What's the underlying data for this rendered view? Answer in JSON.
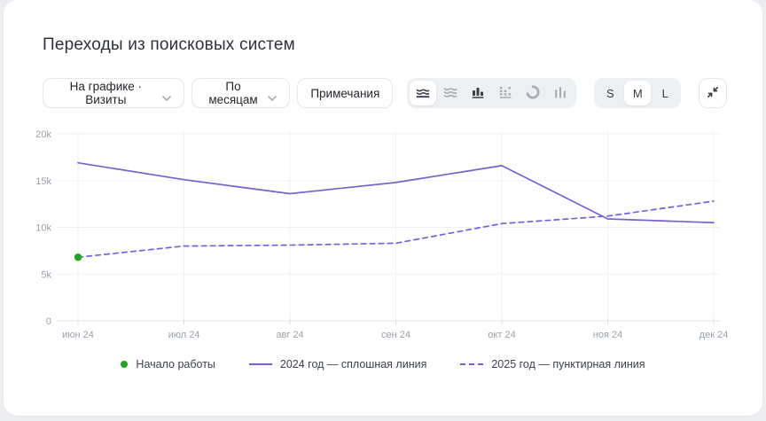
{
  "card": {
    "title": "Переходы из поисковых систем"
  },
  "controls": {
    "metric_dropdown": "На графике · Визиты",
    "period_dropdown": "По месяцам",
    "notes_button": "Примечания",
    "chart_types": [
      {
        "name": "line-chart",
        "selected": true
      },
      {
        "name": "stacked-area-chart",
        "selected": false
      },
      {
        "name": "bar-chart",
        "selected": false
      },
      {
        "name": "stacked-bar-chart",
        "selected": false
      },
      {
        "name": "donut-chart",
        "selected": false
      },
      {
        "name": "column-chart",
        "selected": false
      }
    ],
    "size_options": [
      {
        "label": "S",
        "selected": false
      },
      {
        "label": "M",
        "selected": true
      },
      {
        "label": "L",
        "selected": false
      }
    ],
    "collapse_icon": "collapse-arrows"
  },
  "colors": {
    "solid_line": "#7a5fd0",
    "dashed_line": "#6f63e2",
    "annotation_green": "#22a522",
    "grid": "#eff1f4",
    "axis": "#e3e6eb",
    "tick_text": "#9aa1aa"
  },
  "chart_data": {
    "type": "line",
    "categories": [
      "июн 24",
      "июл 24",
      "авг 24",
      "сен 24",
      "окт 24",
      "ноя 24",
      "дек 24"
    ],
    "series": [
      {
        "name": "2024 год — сплошная линия",
        "style": "solid",
        "color": "#7a5fd0",
        "values": [
          16900,
          15100,
          13600,
          14800,
          16600,
          10900,
          10500
        ]
      },
      {
        "name": "2025 год — пунктирная линия",
        "style": "dashed",
        "color": "#6f63e2",
        "values": [
          6800,
          8000,
          8100,
          8300,
          10400,
          11200,
          12800
        ]
      }
    ],
    "annotations": [
      {
        "label": "Начало работы",
        "category": "июн 24",
        "value": 6800,
        "color": "#22a522"
      }
    ],
    "ylim": [
      0,
      20000
    ],
    "yticks": [
      "0",
      "5k",
      "10k",
      "15k",
      "20k"
    ],
    "grid": true,
    "legend_position": "bottom"
  }
}
